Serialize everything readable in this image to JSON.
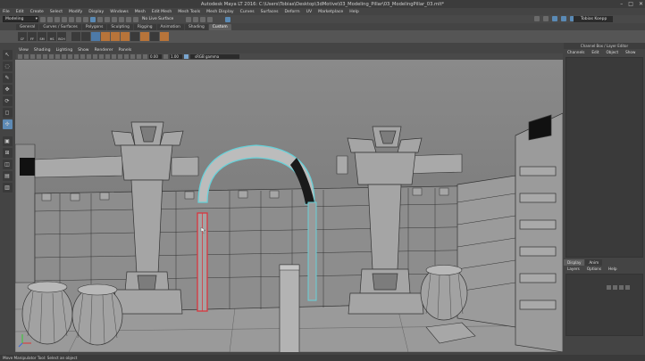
{
  "window": {
    "title": "Autodesk Maya LT 2016: C:\\Users\\Tobias\\Desktop\\3dMotive\\03_Modeling_Pillar\\03_ModelingPillar_03.mlt*",
    "controls": [
      "–",
      "□",
      "✕"
    ]
  },
  "menubar": [
    "File",
    "Edit",
    "Create",
    "Select",
    "Modify",
    "Display",
    "Windows",
    "Mesh",
    "Edit Mesh",
    "Mesh Tools",
    "Mesh Display",
    "Curves",
    "Surfaces",
    "Deform",
    "UV",
    "Marketplace",
    "Help"
  ],
  "status_line": {
    "mode": "Modeling",
    "live_surface": "No Live Surface",
    "user": "Tobias Koepp"
  },
  "shelf": {
    "tabs": [
      "General",
      "Curves / Surfaces",
      "Polygons",
      "Sculpting",
      "Rigging",
      "Animation",
      "Shading",
      "Custom"
    ],
    "active_tab": "Custom",
    "icons": [
      "CF",
      "FF",
      "SM",
      "HS",
      "BCH",
      "",
      "",
      "",
      "",
      "",
      "",
      "",
      "",
      "",
      ""
    ]
  },
  "panel_menu": [
    "View",
    "Shading",
    "Lighting",
    "Show",
    "Renderer",
    "Panels"
  ],
  "panel_toolbar": {
    "val1": "0.00",
    "val2": "1.00",
    "color_space": "sRGB gamma"
  },
  "right_panel": {
    "title": "Channel Box / Layer Editor",
    "menu": [
      "Channels",
      "Edit",
      "Object",
      "Show"
    ],
    "tabs": [
      "Display",
      "Anim"
    ],
    "active_tab": "Display",
    "layer_menu": [
      "Layers",
      "Options",
      "Help"
    ]
  },
  "status_bar": {
    "text": "Move Manipulator Tool: Select an object"
  },
  "colors": {
    "selection_red": "#d9373f",
    "highlight_cyan": "#66d1d9",
    "accent_blue": "#5d8ab5"
  }
}
